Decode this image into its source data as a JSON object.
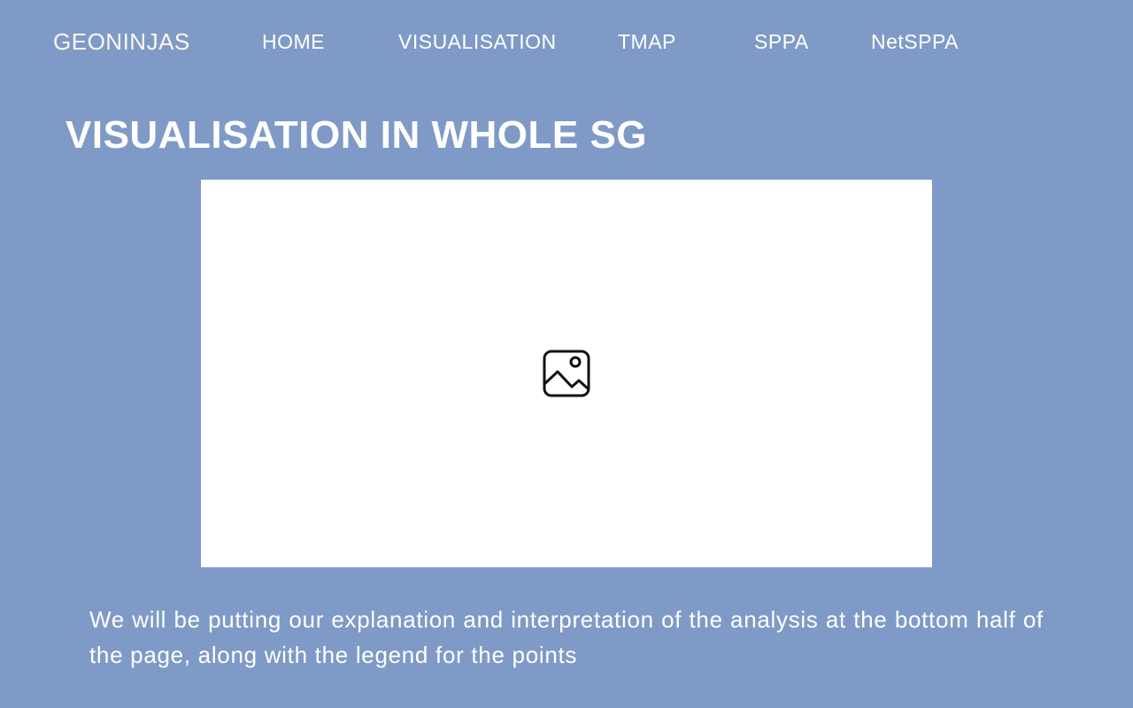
{
  "nav": {
    "brand": "GEONINJAS",
    "links": [
      {
        "label": "HOME"
      },
      {
        "label": "VISUALISATION"
      },
      {
        "label": "TMAP"
      },
      {
        "label": "SPPA"
      },
      {
        "label": "NetSPPA"
      }
    ]
  },
  "main": {
    "title": "VISUALISATION IN WHOLE SG",
    "image": {
      "icon": "image-placeholder-icon"
    },
    "description": "We will be putting our explanation and interpretation of the analysis at the bottom half of the page, along with the legend for the points"
  },
  "colors": {
    "background": "#7f9ac7",
    "text": "#ffffff",
    "brand_text": "#fff6f0",
    "image_area": "#ffffff"
  }
}
